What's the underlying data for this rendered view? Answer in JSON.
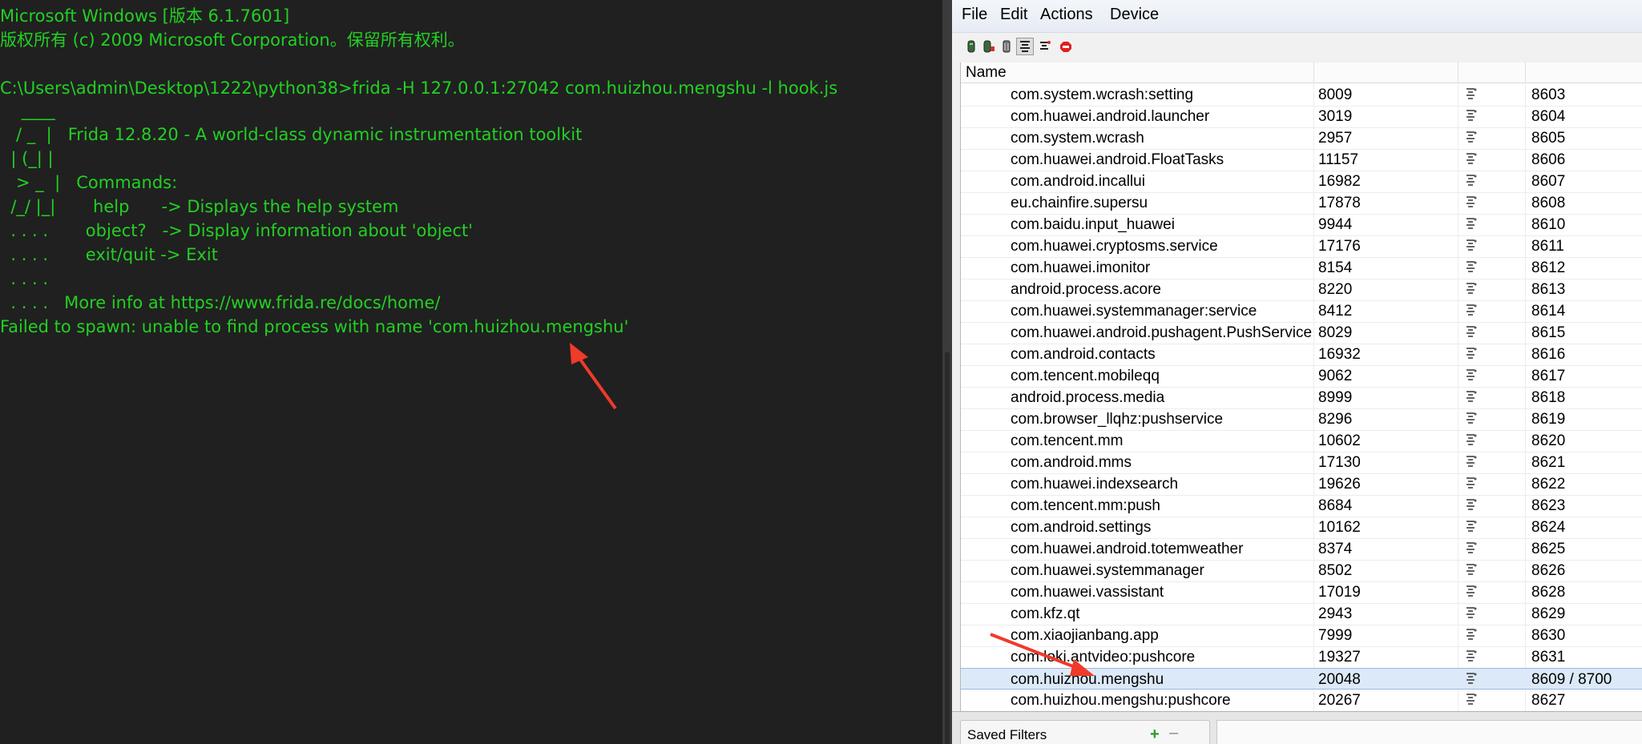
{
  "terminal": {
    "lines": [
      "Microsoft Windows [版本 6.1.7601]",
      "版权所有 (c) 2009 Microsoft Corporation。保留所有权利。",
      "",
      "C:\\Users\\admin\\Desktop\\1222\\python38>frida -H 127.0.0.1:27042 com.huizhou.mengshu -l hook.js",
      "    ____",
      "   / _  |   Frida 12.8.20 - A world-class dynamic instrumentation toolkit",
      "  | (_| |",
      "   > _  |   Commands:",
      "  /_/ |_|       help      -> Displays the help system",
      "  . . . .       object?   -> Display information about 'object'",
      "  . . . .       exit/quit -> Exit",
      "  . . . .",
      "  . . . .   More info at https://www.frida.re/docs/home/",
      "Failed to spawn: unable to find process with name 'com.huizhou.mengshu'"
    ]
  },
  "ddms": {
    "menu": [
      "File",
      "Edit",
      "Actions",
      "Device"
    ],
    "toolbar_icons": [
      "update-heap-icon",
      "dump-hprof-icon",
      "cause-gc-icon",
      "update-threads-icon",
      "start-method-profiling-icon",
      "stop-process-icon"
    ],
    "table": {
      "columns": [
        "Name",
        "",
        "",
        ""
      ],
      "rows": [
        {
          "name": "com.system.wcrash:setting",
          "pid": "8009",
          "port": "8603"
        },
        {
          "name": "com.huawei.android.launcher",
          "pid": "3019",
          "port": "8604"
        },
        {
          "name": "com.system.wcrash",
          "pid": "2957",
          "port": "8605"
        },
        {
          "name": "com.huawei.android.FloatTasks",
          "pid": "11157",
          "port": "8606"
        },
        {
          "name": "com.android.incallui",
          "pid": "16982",
          "port": "8607"
        },
        {
          "name": "eu.chainfire.supersu",
          "pid": "17878",
          "port": "8608"
        },
        {
          "name": "com.baidu.input_huawei",
          "pid": "9944",
          "port": "8610"
        },
        {
          "name": "com.huawei.cryptosms.service",
          "pid": "17176",
          "port": "8611"
        },
        {
          "name": "com.huawei.imonitor",
          "pid": "8154",
          "port": "8612"
        },
        {
          "name": "android.process.acore",
          "pid": "8220",
          "port": "8613"
        },
        {
          "name": "com.huawei.systemmanager:service",
          "pid": "8412",
          "port": "8614"
        },
        {
          "name": "com.huawei.android.pushagent.PushService",
          "pid": "8029",
          "port": "8615"
        },
        {
          "name": "com.android.contacts",
          "pid": "16932",
          "port": "8616"
        },
        {
          "name": "com.tencent.mobileqq",
          "pid": "9062",
          "port": "8617"
        },
        {
          "name": "android.process.media",
          "pid": "8999",
          "port": "8618"
        },
        {
          "name": "com.browser_llqhz:pushservice",
          "pid": "8296",
          "port": "8619"
        },
        {
          "name": "com.tencent.mm",
          "pid": "10602",
          "port": "8620"
        },
        {
          "name": "com.android.mms",
          "pid": "17130",
          "port": "8621"
        },
        {
          "name": "com.huawei.indexsearch",
          "pid": "19626",
          "port": "8622"
        },
        {
          "name": "com.tencent.mm:push",
          "pid": "8684",
          "port": "8623"
        },
        {
          "name": "com.android.settings",
          "pid": "10162",
          "port": "8624"
        },
        {
          "name": "com.huawei.android.totemweather",
          "pid": "8374",
          "port": "8625"
        },
        {
          "name": "com.huawei.systemmanager",
          "pid": "8502",
          "port": "8626"
        },
        {
          "name": "com.huawei.vassistant",
          "pid": "17019",
          "port": "8628"
        },
        {
          "name": "com.kfz.qt",
          "pid": "2943",
          "port": "8629"
        },
        {
          "name": "com.xiaojianbang.app",
          "pid": "7999",
          "port": "8630"
        },
        {
          "name": "com.loki.antvideo:pushcore",
          "pid": "19327",
          "port": "8631"
        },
        {
          "name": "com.huizhou.mengshu",
          "pid": "20048",
          "port": "8609 / 8700",
          "selected": true
        },
        {
          "name": "com.huizhou.mengshu:pushcore",
          "pid": "20267",
          "port": "8627"
        }
      ]
    },
    "saved_filters_label": "Saved Filters"
  },
  "colors": {
    "terminal_text": "#22d022",
    "terminal_bg": "#202020",
    "arrow": "#f03a2a",
    "selected_row": "#dce9f8"
  }
}
